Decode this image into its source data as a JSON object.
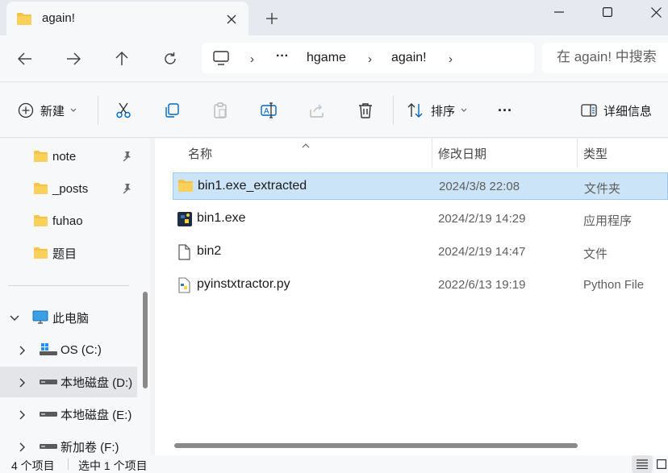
{
  "window": {
    "tab_title": "again!"
  },
  "navigation": {
    "breadcrumbs": [
      "hgame",
      "again!"
    ],
    "ellipsis": "···",
    "search_placeholder": "在 again! 中搜索"
  },
  "toolbar": {
    "new_label": "新建",
    "sort_label": "排序",
    "more_label": "···",
    "details_label": "详细信息"
  },
  "sidebar": {
    "quick_access": [
      {
        "label": "note",
        "pinned": true
      },
      {
        "label": "_posts",
        "pinned": true
      },
      {
        "label": "fuhao",
        "pinned": false
      },
      {
        "label": "题目",
        "pinned": false
      }
    ],
    "this_pc": "此电脑",
    "drives": [
      {
        "label": "OS (C:)",
        "icon": "os-drive-icon",
        "selected": false
      },
      {
        "label": "本地磁盘 (D:)",
        "icon": "drive-icon",
        "selected": true
      },
      {
        "label": "本地磁盘 (E:)",
        "icon": "drive-icon",
        "selected": false
      },
      {
        "label": "新加卷 (F:)",
        "icon": "drive-icon",
        "selected": false
      }
    ]
  },
  "columns": {
    "name": "名称",
    "date": "修改日期",
    "type": "类型"
  },
  "files": [
    {
      "name": "bin1.exe_extracted",
      "date": "2024/3/8 22:08",
      "type": "文件夹",
      "icon": "folder-icon",
      "selected": true
    },
    {
      "name": "bin1.exe",
      "date": "2024/2/19 14:29",
      "type": "应用程序",
      "icon": "python-exe-icon",
      "selected": false
    },
    {
      "name": "bin2",
      "date": "2024/2/19 14:47",
      "type": "文件",
      "icon": "blank-file-icon",
      "selected": false
    },
    {
      "name": "pyinstxtractor.py",
      "date": "2022/6/13 19:19",
      "type": "Python File",
      "icon": "python-file-icon",
      "selected": false
    }
  ],
  "status": {
    "item_count": "4 个项目",
    "selected_count": "选中 1 个项目"
  },
  "colors": {
    "folder": "#f4c245",
    "selection": "#cce4f7",
    "accent": "#0067c0"
  }
}
